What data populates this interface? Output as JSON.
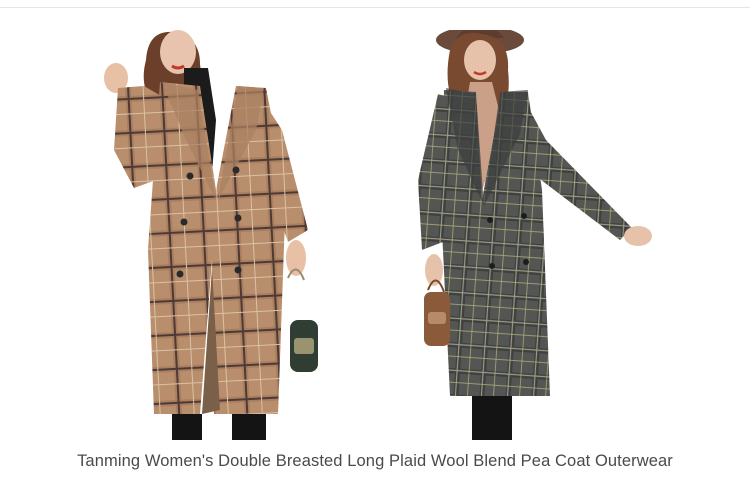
{
  "product": {
    "title": "Tanming Women's Double Breasted Long Plaid Wool Blend Pea Coat Outerwear",
    "colors": {
      "camel_coat": "#b08664",
      "grey_coat": "#4e514f",
      "title_text": "#4a4a4a"
    }
  }
}
